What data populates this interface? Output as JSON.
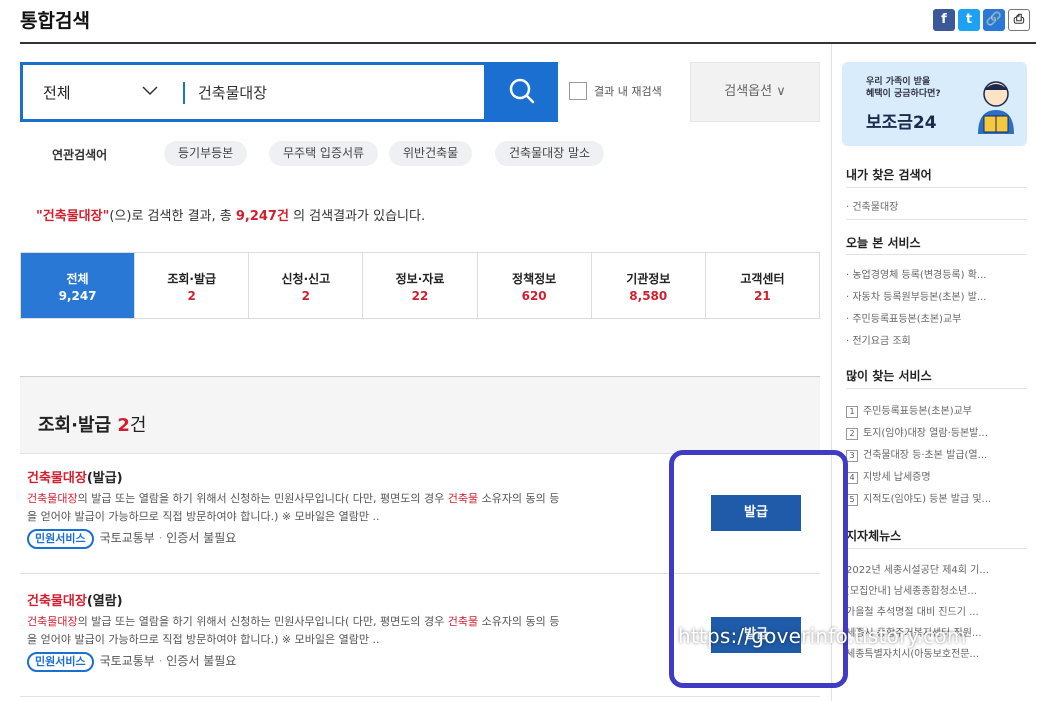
{
  "page": {
    "title": "통합검색"
  },
  "share": {
    "facebook": "f",
    "twitter": "t",
    "link": "🔗",
    "print": "⎙"
  },
  "search": {
    "scope": "전체",
    "query": "건축물대장",
    "re_search_label": "결과 내 재검색",
    "options_label": "검색옵션 ∨"
  },
  "related": {
    "label": "연관검색어",
    "chips": [
      "등기부등본",
      "무주택 입증서류",
      "위반건축물",
      "건축물대장 말소"
    ]
  },
  "summary": {
    "keyword": "\"건축물대장\"",
    "pre": "(으)로 검색한 결과, 총 ",
    "count": "9,247건",
    "post": " 의 검색결과가 있습니다."
  },
  "tabs": [
    {
      "name": "전체",
      "count": "9,247"
    },
    {
      "name": "조회·발급",
      "count": "2"
    },
    {
      "name": "신청·신고",
      "count": "2"
    },
    {
      "name": "정보·자료",
      "count": "22"
    },
    {
      "name": "정책정보",
      "count": "620"
    },
    {
      "name": "기관정보",
      "count": "8,580"
    },
    {
      "name": "고객센터",
      "count": "21"
    }
  ],
  "section": {
    "title": "조회·발급 ",
    "count": "2",
    "unit": "건"
  },
  "results": [
    {
      "title_red": "건축물대장",
      "title_rest": "(발급)",
      "desc_red1": "건축물대장",
      "desc_1": "의 발급 또는 열람을 하기 위해서 신청하는 민원사무입니다( 다만, 평면도의 경우 ",
      "desc_red2": "건축물",
      "desc_2": " 소유자의 동의 등",
      "desc_3": "을 얻어야 발급이 가능하므로 직접 방문하여야 합니다.) ※ 모바일은 열람만 ..",
      "badge": "민원서비스",
      "org": "국토교통부",
      "cert": "인증서 불필요",
      "button": "발급"
    },
    {
      "title_red": "건축물대장",
      "title_rest": "(열람)",
      "desc_red1": "건축물대장",
      "desc_1": "의 발급 또는 열람을 하기 위해서 신청하는 민원사무입니다( 다만, 평면도의 경우 ",
      "desc_red2": "건축물",
      "desc_2": " 소유자의 동의 등",
      "desc_3": "을 얻어야 발급이 가능하므로 직접 방문하여야 합니다.) ※ 모바일은 열람만 ..",
      "badge": "민원서비스",
      "org": "국토교통부",
      "cert": "인증서 불필요",
      "button": "발급"
    }
  ],
  "watermark": "https://goverinfo.tistory.com",
  "sidebar": {
    "banner_line1": "우리 가족이 받을",
    "banner_line2": "혜택이 궁금하다면?",
    "banner_main": "보조금24",
    "my_searches_title": "내가 찾은 검색어",
    "my_searches": [
      "· 건축물대장"
    ],
    "today_title": "오늘 본 서비스",
    "today": [
      "· 농업경영체 등록(변경등록) 확...",
      "· 자동차 등록원부등본(초본) 발...",
      "· 주민등록표등본(초본)교부",
      "· 전기요금 조회"
    ],
    "popular_title": "많이 찾는 서비스",
    "popular": [
      {
        "rank": "1",
        "text": "주민등록표등본(초본)교부"
      },
      {
        "rank": "2",
        "text": "토지(임야)대장 열람·등본발..."
      },
      {
        "rank": "3",
        "text": "건축물대장 등·초본 발급(열..."
      },
      {
        "rank": "4",
        "text": "지방세 납세증명"
      },
      {
        "rank": "5",
        "text": "지적도(임야도) 등본 발급 및..."
      }
    ],
    "local_news_title": "지자체뉴스",
    "local_news": [
      "2022년 세종시설공단 제4회 기...",
      "[모집안내] 남세종종합청소년...",
      "가을철 추석명절 대비 진드기 ...",
      "세종시 종합주거복지센터 직원...",
      "세종특별자치시(아동보호전문..."
    ]
  },
  "colors": {
    "accent": "#1a6fd1",
    "red": "#d21f2f",
    "highlight": "#3f3bc4"
  }
}
